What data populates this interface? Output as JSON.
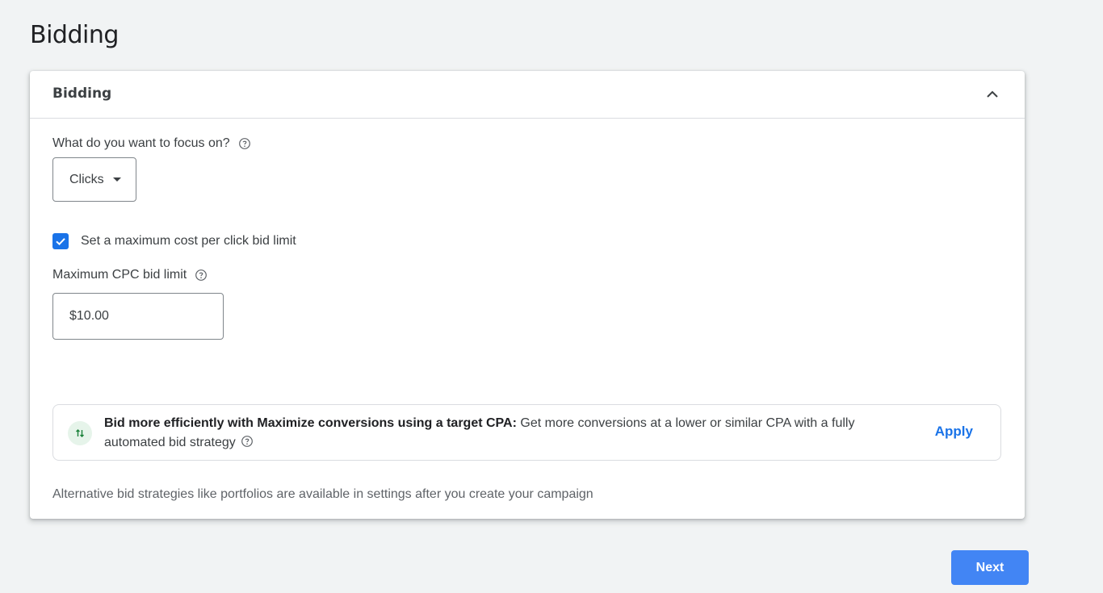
{
  "page": {
    "title": "Bidding"
  },
  "card": {
    "title": "Bidding",
    "focus": {
      "label": "What do you want to focus on?",
      "selected": "Clicks"
    },
    "max_cpc_checkbox": {
      "checked": true,
      "label": "Set a maximum cost per click bid limit"
    },
    "max_cpc": {
      "label": "Maximum CPC bid limit",
      "value": "$10.00"
    },
    "recommendation": {
      "bold": "Bid more efficiently with Maximize conversions using a target CPA:",
      "text": "Get more conversions at a lower or similar CPA with a fully automated bid strategy",
      "apply_label": "Apply"
    },
    "footnote": "Alternative bid strategies like portfolios are available in settings after you create your campaign"
  },
  "next_label": "Next",
  "colors": {
    "accent": "#1a73e8",
    "button": "#4285f4",
    "recommendation_icon_bg": "#e6f4ea",
    "recommendation_icon": "#188038"
  },
  "icons": {
    "collapse": "chevron-up-icon",
    "help": "help-circle-icon",
    "checkbox": "check-icon",
    "recommendation": "swap-vertical-icon"
  }
}
